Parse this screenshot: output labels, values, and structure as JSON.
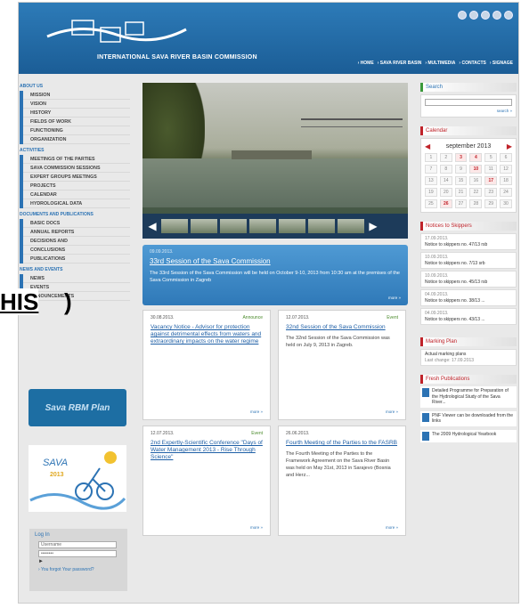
{
  "header": {
    "org_name": "INTERNATIONAL SAVA RIVER BASIN COMMISSION",
    "nav": [
      "› HOME",
      "› SAVA RIVER BASIN",
      "› MULTIMEDIA",
      "› CONTACTS",
      "› SIGNAGE"
    ]
  },
  "sidebar": {
    "about_head": "ABOUT US",
    "about_items": [
      "MISSION",
      "VISION",
      "HISTORY",
      "FIELDS OF WORK",
      "FUNCTIONING",
      "ORGANIZATION"
    ],
    "activities_head": "ACTIVITIES",
    "activities_items": [
      "MEETINGS OF THE PARTIES",
      "SAVA COMMISSION SESSIONS",
      "EXPERT GROUPS MEETINGS",
      "PROJECTS",
      "CALENDAR",
      "HYDROLOGICAL DATA"
    ],
    "docs_head": "DOCUMENTS AND PUBLICATIONS",
    "docs_items": [
      "BASIC DOCS",
      "ANNUAL REPORTS",
      "DECISIONS AND",
      "CONCLUSIONS",
      "PUBLICATIONS"
    ],
    "news_head": "NEWS AND EVENTS",
    "news_items": [
      "NEWS",
      "EVENTS",
      "ANNOUNCEMENTS"
    ],
    "banner": "Sava RBM Plan",
    "sava_logo_text": "SAVA",
    "sava_year": "2013"
  },
  "login": {
    "title": "Log In",
    "username": "Username",
    "password": "••••••••",
    "forgot": "› You forgot Your password?"
  },
  "overlay": {
    "label": "HIS",
    "paren": ")"
  },
  "featured": {
    "date": "09.09.2013.",
    "title": "33rd Session of the Sava Commission",
    "body": "The 33rd Session of the Sava Commission will be held on October 9-10, 2013 from 10:30 am at the premises of the Sava Commission in Zagreb",
    "more": "more »"
  },
  "cards": [
    {
      "date": "30.08.2013.",
      "type": "Announce",
      "title": "Vacancy Notice - Advisor for protection against detrimental effects from waters and extraordinary impacts on the water regime",
      "body": "",
      "more": "more »"
    },
    {
      "date": "12.07.2013.",
      "type": "Event",
      "title": "32nd Session of the Sava Commission",
      "body": "The 32nd Session of the Sava Commission was held on July 9, 2013 in Zagreb.",
      "more": "more »"
    },
    {
      "date": "12.07.2013.",
      "type": "Event",
      "title": "2nd Expertly-Scientific Conference \"Days of Water Management 2013 - Rise Through Science\"",
      "body": "",
      "more": "more »"
    },
    {
      "date": "26.06.2013.",
      "type": "Event",
      "title": "Fourth Meeting of the Parties to the FASRB",
      "body": "The Fourth Meeting of the Parties to the Framework Agreement on the Sava River Basin was held on May 31st, 2013 in Sarajevo (Bosnia and Herz...",
      "more": "more »"
    }
  ],
  "right": {
    "search_head": "Search",
    "search_go": "search »",
    "calendar_head": "Calendar",
    "month": "september 2013",
    "days": [
      "1",
      "2",
      "3",
      "4",
      "5",
      "6",
      "7",
      "8",
      "9",
      "10",
      "11",
      "12",
      "13",
      "14",
      "15",
      "16",
      "17",
      "18",
      "19",
      "20",
      "21",
      "22",
      "23",
      "24",
      "25",
      "26",
      "27",
      "28",
      "29",
      "30"
    ],
    "event_days": [
      "3",
      "4",
      "10",
      "17",
      "26"
    ],
    "notices_head": "Notices to Skippers",
    "notices": [
      {
        "date": "17.09.2013.",
        "text": "Notice to skippers no. 47/13 rsb"
      },
      {
        "date": "10.09.2013.",
        "text": "Notice to skippers no. 7/13 srb"
      },
      {
        "date": "10.09.2013.",
        "text": "Notice to skippers no. 45/13 rsb"
      },
      {
        "date": "04.09.2013.",
        "text": "Notice to skippers no. 38/13 ..."
      },
      {
        "date": "04.09.2013.",
        "text": "Notice to skippers no. 43/13 ..."
      }
    ],
    "marking_head": "Marking Plan",
    "marking_text": "Actual marking plans",
    "marking_date": "Last change: 17.09.2013",
    "pubs_head": "Fresh Publications",
    "pubs": [
      "Detailed Programme for Preparation of the Hydrological Study of the Sava River...",
      "PNF Viewer can be downloaded from the links",
      "The 2009 Hydrological Yearbook"
    ]
  }
}
